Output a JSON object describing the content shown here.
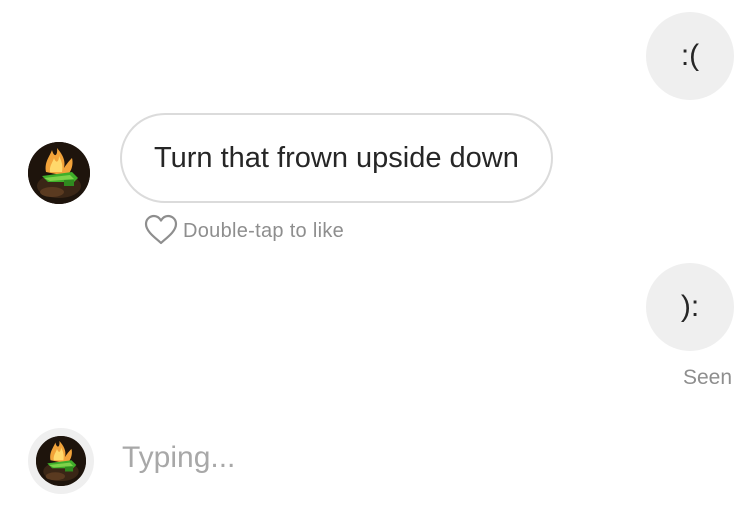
{
  "messages": {
    "outgoing_1": ":(",
    "incoming_1": "Turn that frown upside down",
    "like_hint": "Double-tap to like",
    "outgoing_2": "):",
    "seen_status": "Seen",
    "typing_indicator": "Typing..."
  },
  "icons": {
    "like": "heart-outline-icon",
    "avatar": "fire-avatar-image"
  },
  "colors": {
    "outgoing_bubble": "#efefef",
    "incoming_border": "#dbdbdb",
    "text": "#262626",
    "meta_text": "#8e8e8e"
  }
}
